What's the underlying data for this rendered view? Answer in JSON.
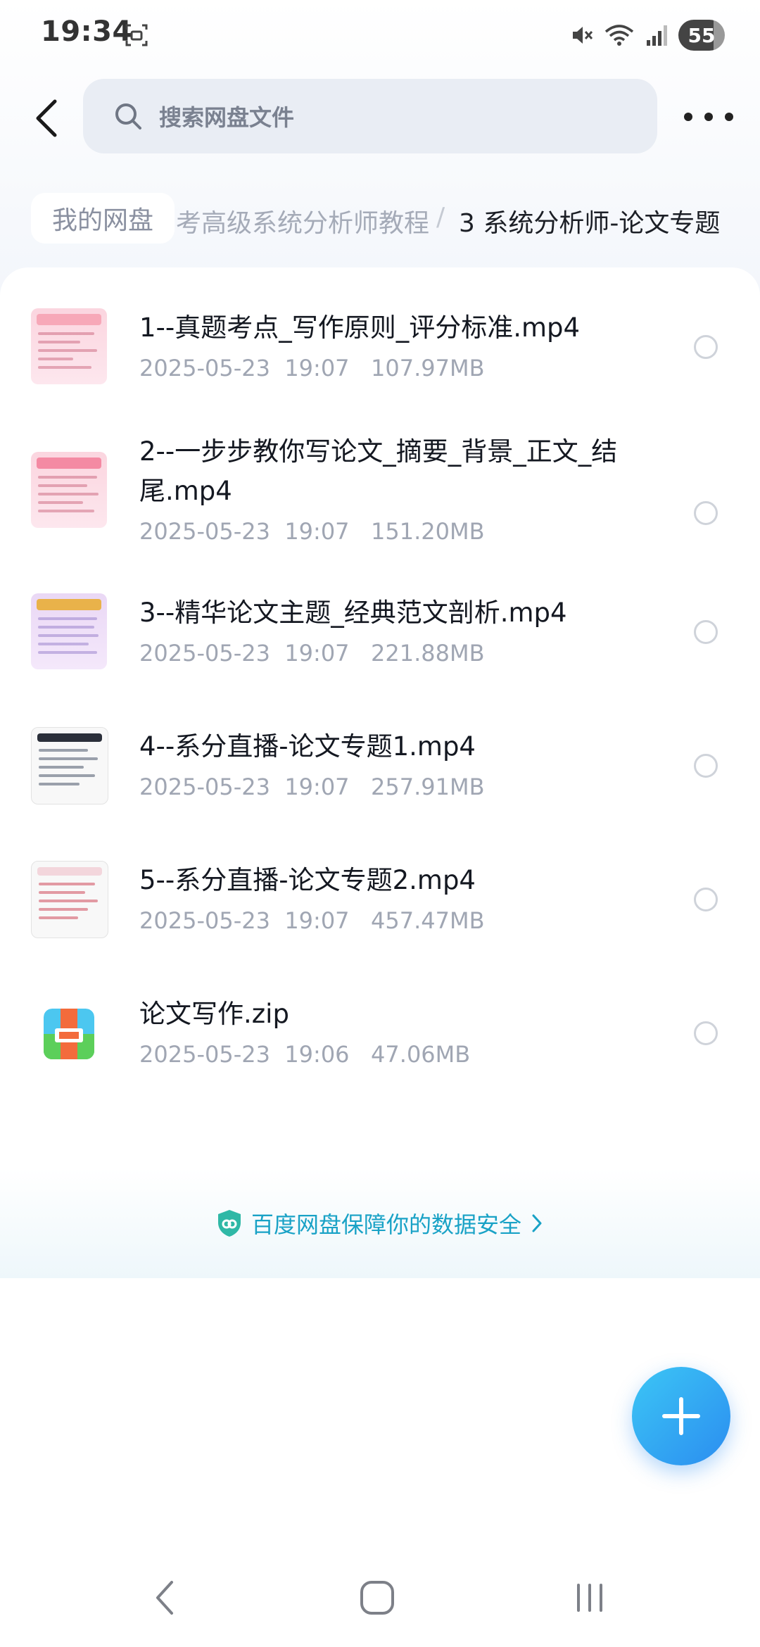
{
  "status_bar": {
    "time": "19:34",
    "battery": "55"
  },
  "header": {
    "search_placeholder": "搜索网盘文件"
  },
  "breadcrumb": {
    "root": "我的网盘",
    "middle": "考高级系统分析师教程",
    "separator": "/",
    "current": "3 系统分析师-论文专题"
  },
  "files": [
    {
      "name": "1--真题考点_写作原则_评分标准.mp4",
      "meta": "2025-05-23  19:07   107.97MB",
      "thumb": "video-thumbnail"
    },
    {
      "name": "2--一步步教你写论文_摘要_背景_正文_结尾.mp4",
      "meta": "2025-05-23  19:07   151.20MB",
      "thumb": "video-thumbnail"
    },
    {
      "name": "3--精华论文主题_经典范文剖析.mp4",
      "meta": "2025-05-23  19:07   221.88MB",
      "thumb": "video-thumbnail"
    },
    {
      "name": "4--系分直播-论文专题1.mp4",
      "meta": "2025-05-23  19:07   257.91MB",
      "thumb": "video-thumbnail"
    },
    {
      "name": "5--系分直播-论文专题2.mp4",
      "meta": "2025-05-23  19:07   457.47MB",
      "thumb": "video-thumbnail"
    },
    {
      "name": "论文写作.zip",
      "meta": "2025-05-23  19:06   47.06MB",
      "thumb": "zip-archive-icon"
    }
  ],
  "security_banner": {
    "text": "百度网盘保障你的数据安全"
  },
  "colors": {
    "accent": "#2b8df0",
    "security_text": "#19a2c6",
    "search_bg": "#e9edf4"
  }
}
